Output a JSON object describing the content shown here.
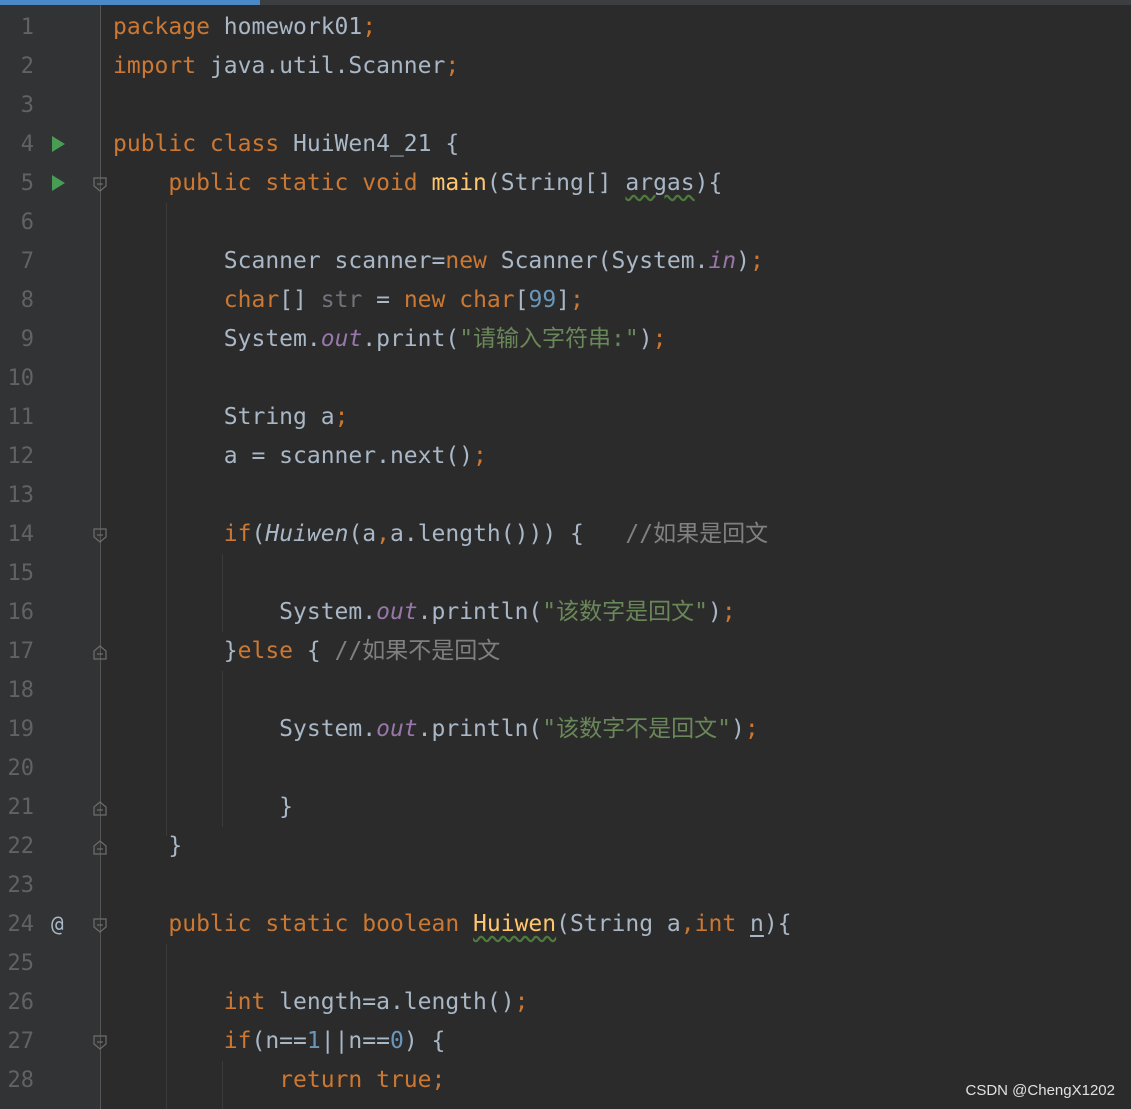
{
  "lines": [
    {
      "n": "1"
    },
    {
      "n": "2"
    },
    {
      "n": "3"
    },
    {
      "n": "4"
    },
    {
      "n": "5"
    },
    {
      "n": "6"
    },
    {
      "n": "7"
    },
    {
      "n": "8"
    },
    {
      "n": "9"
    },
    {
      "n": "10"
    },
    {
      "n": "11"
    },
    {
      "n": "12"
    },
    {
      "n": "13"
    },
    {
      "n": "14"
    },
    {
      "n": "15"
    },
    {
      "n": "16"
    },
    {
      "n": "17"
    },
    {
      "n": "18"
    },
    {
      "n": "19"
    },
    {
      "n": "20"
    },
    {
      "n": "21"
    },
    {
      "n": "22"
    },
    {
      "n": "23"
    },
    {
      "n": "24"
    },
    {
      "n": "25"
    },
    {
      "n": "26"
    },
    {
      "n": "27"
    },
    {
      "n": "28"
    }
  ],
  "code": {
    "l1_kw": "package",
    "l1_a": " homework01",
    "l1_semi": ";",
    "l2_kw": "import",
    "l2_a": " java.util.Scanner",
    "l2_semi": ";",
    "l4_kw": "public class",
    "l4_a": " HuiWen4_21 {",
    "l5_kw": "public static void",
    "l5_sp": " ",
    "l5_fn": "main",
    "l5_a": "(String[] ",
    "l5_param": "argas",
    "l5_b": "){",
    "l7_a": "Scanner scanner=",
    "l7_kw": "new",
    "l7_b": " Scanner(System.",
    "l7_fld": "in",
    "l7_c": ")",
    "l7_semi": ";",
    "l8_kw1": "char",
    "l8_a": "[] ",
    "l8_gray": "str",
    "l8_b": " = ",
    "l8_kw2": "new",
    "l8_sp": " ",
    "l8_kw3": "char",
    "l8_c": "[",
    "l8_num": "99",
    "l8_d": "]",
    "l8_semi": ";",
    "l9_a": "System.",
    "l9_fld": "out",
    "l9_b": ".print(",
    "l9_str": "\"请输入字符串:\"",
    "l9_c": ")",
    "l9_semi": ";",
    "l11_a": "String a",
    "l11_semi": ";",
    "l12_a": "a = scanner.next()",
    "l12_semi": ";",
    "l14_kw": "if",
    "l14_a": "(",
    "l14_it": "Huiwen",
    "l14_b": "(a",
    "l14_comma": ",",
    "l14_c": "a.length())) {   ",
    "l14_cm": "//如果是回文",
    "l16_a": "System.",
    "l16_fld": "out",
    "l16_b": ".println(",
    "l16_str": "\"该数字是回文\"",
    "l16_c": ")",
    "l16_semi": ";",
    "l17_a": "}",
    "l17_kw": "else",
    "l17_b": " { ",
    "l17_cm": "//如果不是回文",
    "l19_a": "System.",
    "l19_fld": "out",
    "l19_b": ".println(",
    "l19_str": "\"该数字不是回文\"",
    "l19_c": ")",
    "l19_semi": ";",
    "l21_a": "}",
    "l22_a": "}",
    "l24_kw": "public static boolean",
    "l24_sp": " ",
    "l24_fn": "Huiwen",
    "l24_a": "(String a",
    "l24_comma": ",",
    "l24_kw2": "int",
    "l24_sp2": " ",
    "l24_n": "n",
    "l24_b": "){",
    "l26_kw": "int",
    "l26_a": " length=a.length()",
    "l26_semi": ";",
    "l27_kw": "if",
    "l27_a": "(n==",
    "l27_num1": "1",
    "l27_b": "||n==",
    "l27_num2": "0",
    "l27_c": ") {",
    "l28_kw": "return true",
    "l28_semi": ";"
  },
  "gutter_marks": {
    "override_symbol": "@"
  },
  "watermark": "CSDN @ChengX1202"
}
